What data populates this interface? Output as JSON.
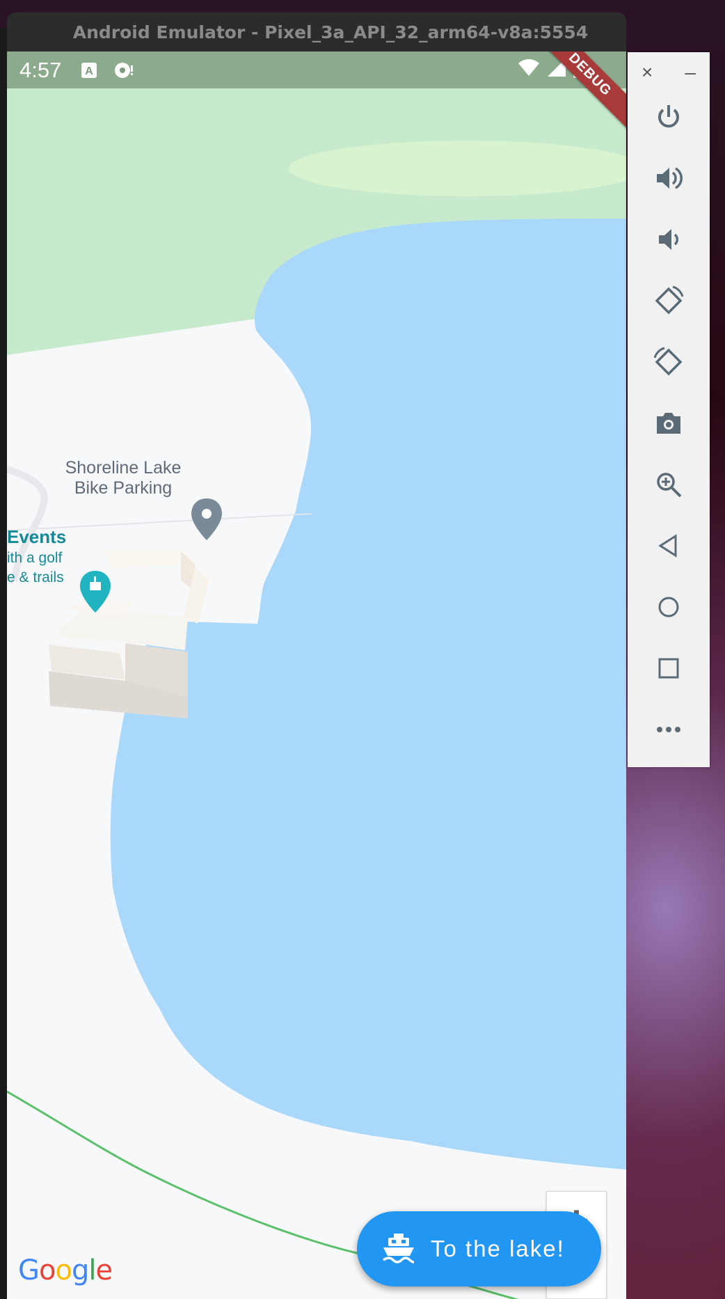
{
  "window": {
    "title": "Android Emulator - Pixel_3a_API_32_arm64-v8a:5554"
  },
  "status_bar": {
    "time": "4:57",
    "left_icons": [
      "notification-a-icon",
      "assistant-icon"
    ],
    "right_icons": [
      "wifi-icon",
      "signal-icon",
      "battery-icon"
    ]
  },
  "debug_banner": "DEBUG",
  "map": {
    "poi_bike_parking": {
      "name_line1": "Shoreline Lake",
      "name_line2": "Bike Parking"
    },
    "poi_events": {
      "title": "Events",
      "line1": "ith a golf",
      "line2": "e & trails"
    },
    "attribution": "Google",
    "colors": {
      "water": "#aad8fb",
      "park": "#c6eacb",
      "land": "#f7f8fa",
      "route": "#5cbf6a"
    }
  },
  "zoom": {
    "in_label": "+"
  },
  "fab": {
    "label": "To the lake!",
    "icon": "boat-icon",
    "color": "#2196f3"
  },
  "side_panel": {
    "header": {
      "close": "×",
      "minimize": "–"
    },
    "buttons": [
      "power-icon",
      "volume-up-icon",
      "volume-down-icon",
      "rotate-left-icon",
      "rotate-right-icon",
      "camera-icon",
      "zoom-icon",
      "back-icon",
      "home-icon",
      "overview-icon",
      "more-icon"
    ]
  }
}
